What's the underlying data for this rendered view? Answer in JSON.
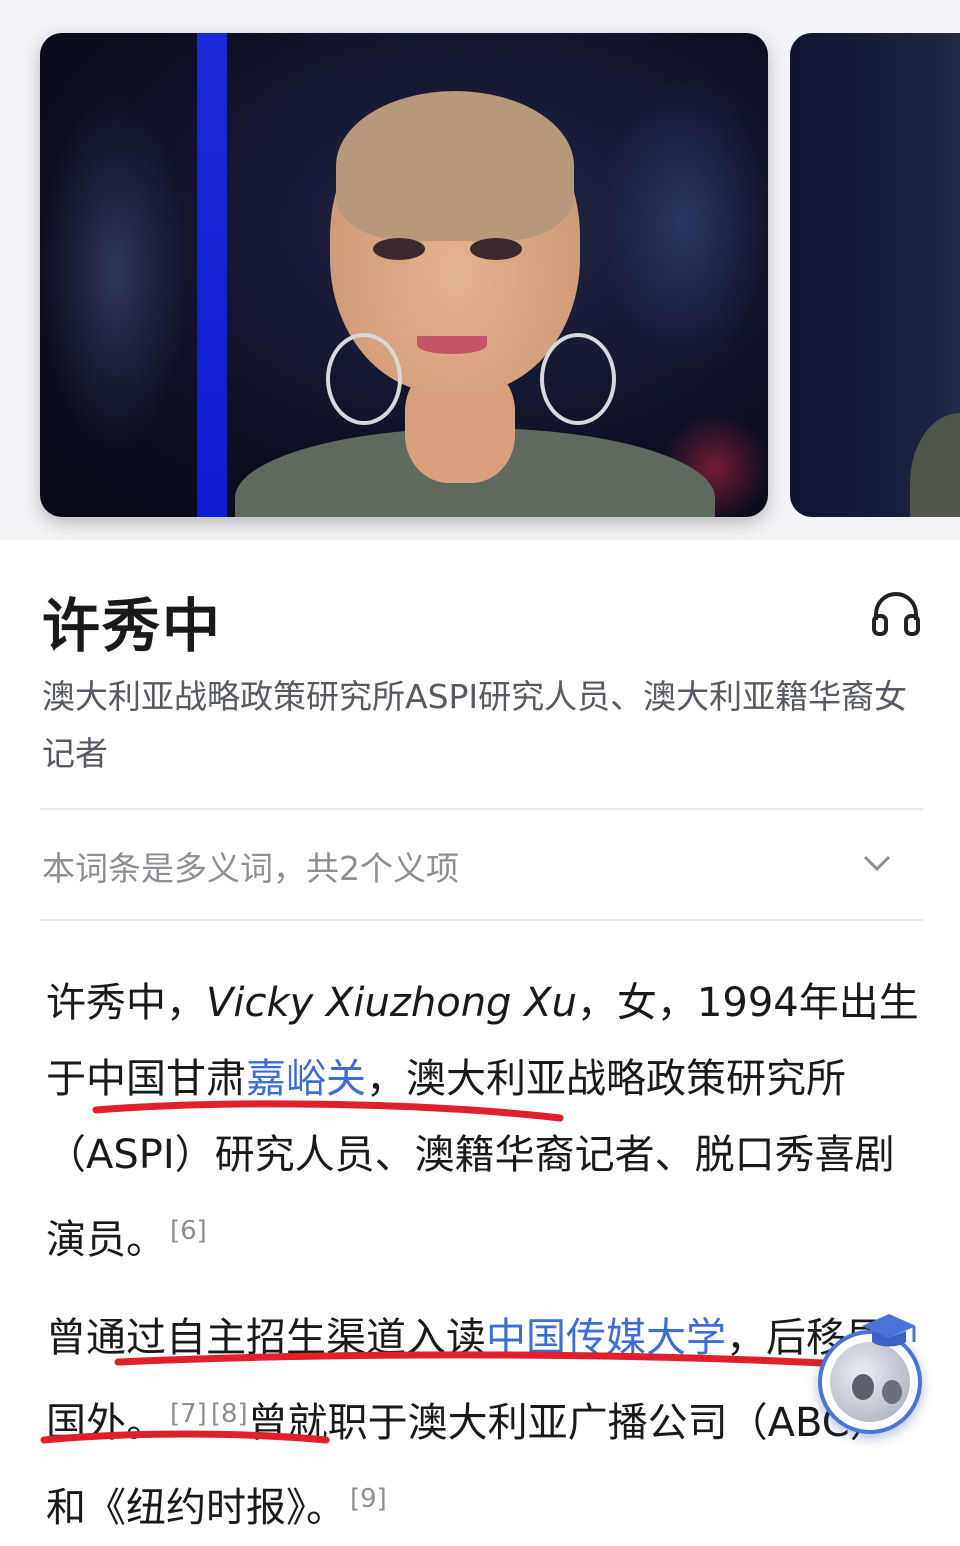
{
  "entry": {
    "title": "许秀中",
    "subtitle": "澳大利亚战略政策研究所ASPI研究人员、澳大利亚籍华裔女记者",
    "polysemy_notice": "本词条是多义词，共2个义项"
  },
  "paragraph1": {
    "t1": "许秀中，",
    "en_name": "Vicky Xiuzhong Xu",
    "t2": "，女，1994年出生于中国甘肃",
    "link_jiayuguan": "嘉峪关",
    "t3": "，澳大利亚战略政策研究所（ASPI）研究人员、澳籍华裔记者、脱口秀喜剧演员。",
    "ref": "[6]"
  },
  "paragraph2": {
    "t1": "曾通过自主招生渠道入读",
    "link_cuc": "中国传媒大学",
    "t2": "，后移居国外。",
    "ref7": "[7]",
    "ref8": "[8]",
    "t3": "曾就职于澳大利亚广播公司（ABC）和《纽约时报》。",
    "ref9": "[9]"
  },
  "colors": {
    "link": "#3d6ed8",
    "underline_marker": "#e0202a",
    "muted": "#8b8f96"
  },
  "icons": [
    "headphones-icon",
    "chevron-down-icon",
    "graduation-cap-icon"
  ]
}
